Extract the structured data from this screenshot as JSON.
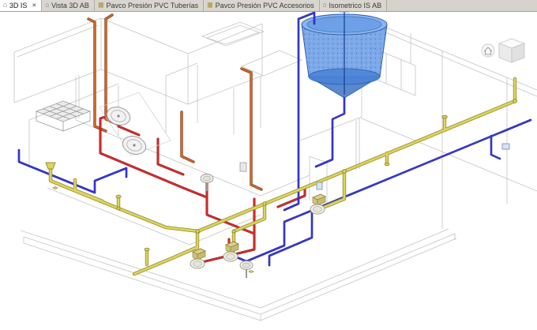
{
  "icons": {
    "view_3d": "⌂",
    "schedule": "▦",
    "close": "✕"
  },
  "tab_bar": {
    "tabs": [
      {
        "label": "3D IS",
        "state": "active",
        "icon": "view-3d-icon",
        "closable": true
      },
      {
        "label": "Vista 3D AB",
        "state": "inactive",
        "icon": "view-3d-icon"
      },
      {
        "label": "Pavco Presión PVC Tuberías",
        "state": "inactive",
        "icon": "schedule-icon"
      },
      {
        "label": "Pavco Presión PVC Accesorios",
        "state": "inactive",
        "icon": "schedule-icon"
      },
      {
        "label": "Isometrico IS AB",
        "state": "inactive",
        "icon": "view-3d-icon"
      }
    ]
  },
  "viewport": {
    "type": "3d-isometric-plumbing-model",
    "background": "#ffffff",
    "palette": {
      "drain_pipe_yellow": "#d9cf55",
      "cold_water_pipe_blue": "#3f3fe0",
      "hot_water_pipe_red": "#e03030",
      "vent_pipe_orange": "#cd6a2e",
      "tank_blue": "#5d94e4",
      "wireframe_gray": "#c4c4c4"
    },
    "visible_elements": [
      "building-wireframe",
      "elevated-water-storage-tank",
      "drain-pipes",
      "cold-water-pipes",
      "hot-water-pipes",
      "vent-pipes",
      "sanitary-fixtures",
      "viewcube"
    ]
  }
}
